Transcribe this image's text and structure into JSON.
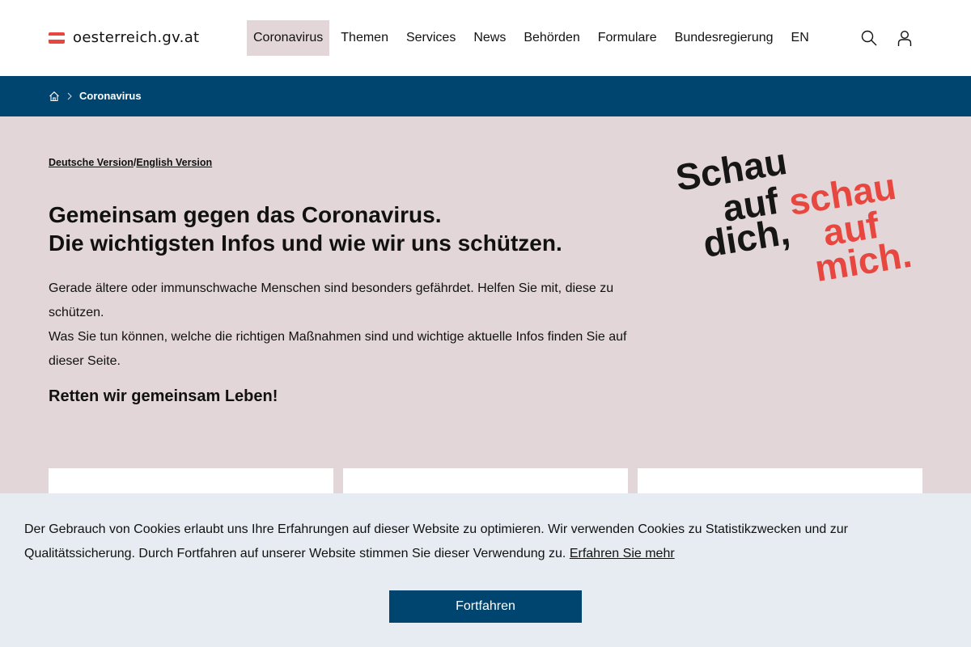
{
  "header": {
    "logo_text": "oesterreich.gv.at",
    "nav": [
      {
        "label": "Coronavirus",
        "active": true
      },
      {
        "label": "Themen"
      },
      {
        "label": "Services"
      },
      {
        "label": "News"
      },
      {
        "label": "Behörden"
      },
      {
        "label": "Formulare"
      },
      {
        "label": "Bundesregierung"
      },
      {
        "label": "EN"
      }
    ],
    "icons": [
      "search-icon",
      "user-icon"
    ]
  },
  "breadcrumb": {
    "home_icon": "home-icon",
    "separator_icon": "chevron-right-icon",
    "current": "Coronavirus"
  },
  "hero": {
    "lang_de": "Deutsche Version",
    "lang_sep": "/",
    "lang_en": "English Version",
    "title_line1": "Gemeinsam gegen das Coronavirus.",
    "title_line2": "Die wichtigsten Infos und wie wir uns schützen.",
    "text_p1": "Gerade ältere oder immunschwache Menschen sind besonders gefährdet. Helfen Sie mit, diese zu schützen.",
    "text_p2": "Was Sie tun können, welche die richtigen Maßnahmen sind und wichtige aktuelle Infos finden Sie auf dieser Seite.",
    "claim": "Retten wir gemeinsam Leben!",
    "slogan_black": [
      "Schau",
      "auf",
      "dich,"
    ],
    "slogan_red": [
      "schau",
      "auf",
      "mich."
    ]
  },
  "cookie": {
    "text": "Der Gebrauch von Cookies erlaubt uns Ihre Erfahrungen auf dieser Website zu optimieren. Wir verwenden Cookies zu Statistikzwecken und zur Qualitätssicherung. Durch Fortfahren auf unserer Website stimmen Sie dieser Verwendung zu.",
    "link": "Erfahren Sie mehr",
    "button": "Fortfahren"
  },
  "colors": {
    "brand_blue": "#00456f",
    "hero_bg": "#e2d6d8",
    "accent_red": "#e8473f",
    "cookie_bg": "#e6ecf1"
  }
}
